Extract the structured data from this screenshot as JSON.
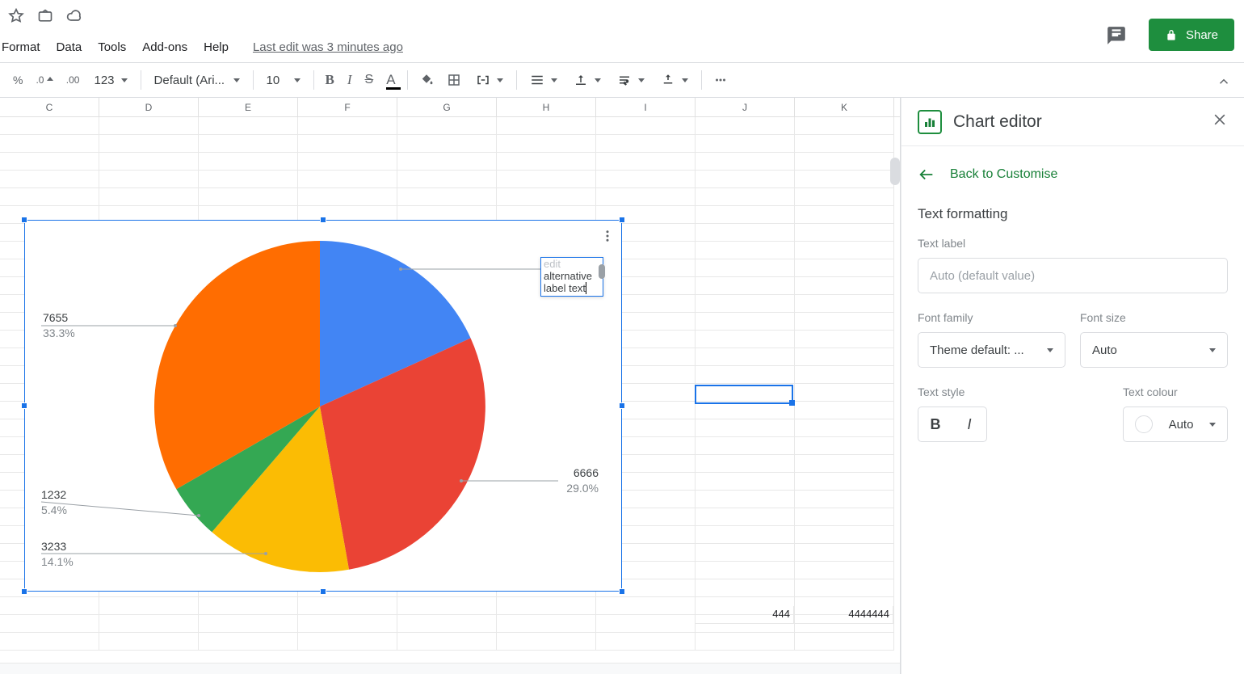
{
  "titlebar": {
    "share_label": "Share"
  },
  "menu": {
    "format": "Format",
    "data": "Data",
    "tools": "Tools",
    "addons": "Add-ons",
    "help": "Help",
    "last_edit": "Last edit was 3 minutes ago"
  },
  "toolbar": {
    "percent": "%",
    "dec_dec": ".0",
    "dec_inc": ".00",
    "more_fmt": "123",
    "font_name": "Default (Ari...",
    "font_size": "10"
  },
  "columns": [
    "C",
    "D",
    "E",
    "F",
    "G",
    "H",
    "I",
    "J",
    "K"
  ],
  "cells": {
    "j_bottom": "444",
    "k_bottom": "4444444"
  },
  "chart_data": {
    "type": "pie",
    "series": [
      {
        "name": "edit alternative label text",
        "value": 4190,
        "percent": "18.2%",
        "color": "#4285f4"
      },
      {
        "name": "6666",
        "value": 6666,
        "percent": "29.0%",
        "color": "#ea4335"
      },
      {
        "name": "3233",
        "value": 3233,
        "percent": "14.1%",
        "color": "#fbbc04"
      },
      {
        "name": "1232",
        "value": 1232,
        "percent": "5.4%",
        "color": "#34a853"
      },
      {
        "name": "7655",
        "value": 7655,
        "percent": "33.3%",
        "color": "#ff6d01"
      }
    ],
    "labels": {
      "l0_a": "edit",
      "l0_b": "alternative",
      "l0_c": "label text",
      "l1_a": "6666",
      "l1_b": "29.0%",
      "l2_a": "3233",
      "l2_b": "14.1%",
      "l3_a": "1232",
      "l3_b": "5.4%",
      "l4_a": "7655",
      "l4_b": "33.3%"
    }
  },
  "editor": {
    "title": "Chart editor",
    "back": "Back to Customise",
    "section": "Text formatting",
    "text_label": "Text label",
    "text_label_placeholder": "Auto (default value)",
    "font_family": "Font family",
    "font_family_value": "Theme default: ...",
    "font_size": "Font size",
    "font_size_value": "Auto",
    "text_style": "Text style",
    "text_colour": "Text colour",
    "text_colour_value": "Auto"
  }
}
